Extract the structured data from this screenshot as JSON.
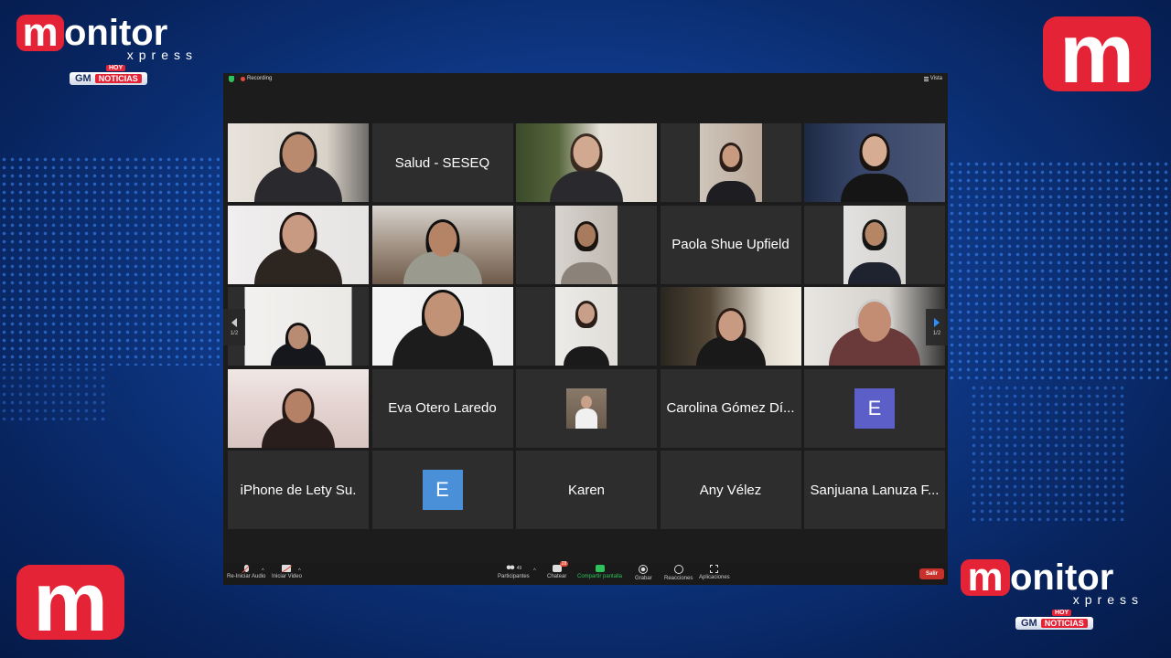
{
  "branding": {
    "wordmark_rest": "onitor",
    "logo_letter": "m",
    "tagline": "xpress",
    "gm_label": "GM",
    "noticias_label": "NOTICIAS",
    "hoy_label": "HOY",
    "brand_red": "#e42337"
  },
  "zoom": {
    "recording_label": "Recording",
    "view_label": "Vista",
    "page_indicator": "1/2",
    "speaking_color": "#46c24a",
    "tiles": [
      {
        "type": "video",
        "scene": "office-man"
      },
      {
        "type": "name",
        "label": "Salud - SESEQ"
      },
      {
        "type": "video",
        "scene": "woman-plants"
      },
      {
        "type": "video",
        "scene": "woman-small"
      },
      {
        "type": "video",
        "scene": "woman-office"
      },
      {
        "type": "video",
        "scene": "woman-glasses"
      },
      {
        "type": "video",
        "scene": "woman-home",
        "speaking": true
      },
      {
        "type": "video",
        "scene": "man-beard"
      },
      {
        "type": "name",
        "label": "Paola Shue Upfield"
      },
      {
        "type": "video",
        "scene": "man-suit"
      },
      {
        "type": "video",
        "scene": "woman-white-room"
      },
      {
        "type": "video",
        "scene": "man-glasses-close"
      },
      {
        "type": "video",
        "scene": "woman-standing"
      },
      {
        "type": "video",
        "scene": "woman-kitchen"
      },
      {
        "type": "video",
        "scene": "old-man"
      },
      {
        "type": "video",
        "scene": "woman-red-wall"
      },
      {
        "type": "name",
        "label": "Eva Otero Laredo"
      },
      {
        "type": "photo",
        "scene": "small-photo"
      },
      {
        "type": "name",
        "label": "Carolina Gómez Dí..."
      },
      {
        "type": "avatar",
        "letter": "E",
        "color": "#5b5fc7"
      },
      {
        "type": "name",
        "label": "iPhone de Lety Su."
      },
      {
        "type": "avatar",
        "letter": "E",
        "color": "#4a90d9"
      },
      {
        "type": "name",
        "label": "Karen"
      },
      {
        "type": "name",
        "label": "Any Vélez"
      },
      {
        "type": "name",
        "label": "Sanjuana Lanuza F..."
      }
    ],
    "toolbar": {
      "audio_label": "Re-Iniciar Audio",
      "video_label": "Iniciar Video",
      "participants_label": "Participantes",
      "participants_count": "49",
      "chat_label": "Chatear",
      "chat_badge": "28",
      "share_label": "Compartir pantalla",
      "record_label": "Grabar",
      "reactions_label": "Reacciones",
      "apps_label": "Aplicaciones",
      "leave_label": "Salir"
    }
  }
}
